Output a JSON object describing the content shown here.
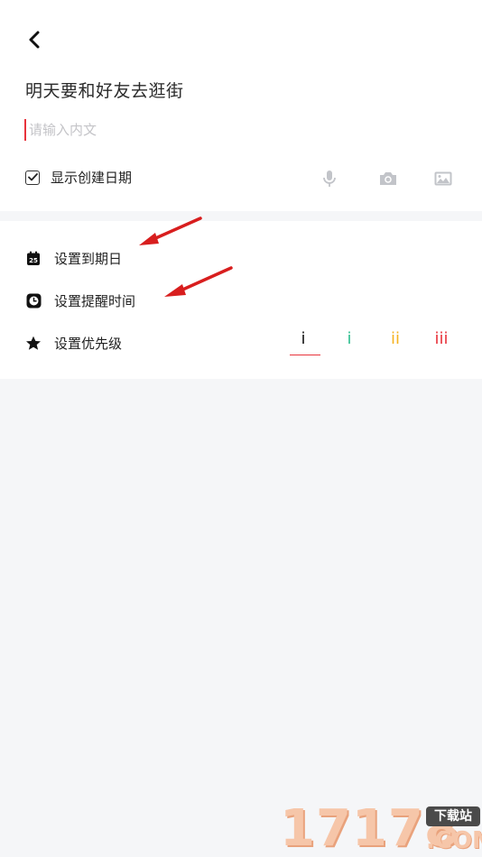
{
  "editor": {
    "title": "明天要和好友去逛街",
    "body_placeholder": "请输入内文",
    "show_date_label": "显示创建日期",
    "show_date_checked": true
  },
  "settings": {
    "due_date_label": "设置到期日",
    "due_date_icon_text": "25",
    "reminder_label": "设置提醒时间",
    "priority_label": "设置优先级",
    "priority_options": [
      "i",
      "i",
      "ii",
      "iii"
    ],
    "priority_selected": 0
  },
  "colors": {
    "accent": "#e8333c",
    "priority_1": "#111111",
    "priority_2": "#2fbf8f",
    "priority_3": "#f5b321",
    "priority_4": "#e8333c",
    "annotation_arrow": "#d81e1e"
  },
  "icons": {
    "back": "chevron-left-icon",
    "mic": "microphone-icon",
    "camera": "camera-icon",
    "image": "image-icon",
    "calendar": "calendar-icon",
    "clock": "clock-icon",
    "star": "star-icon"
  },
  "watermark": {
    "digits": "17178",
    "badge": "下载站",
    "domain": ".COM"
  }
}
